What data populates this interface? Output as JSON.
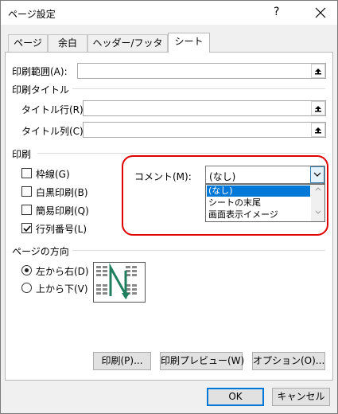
{
  "window": {
    "title": "ページ設定",
    "help_label": "?"
  },
  "tabs": [
    {
      "label": "ページ"
    },
    {
      "label": "余白"
    },
    {
      "label": "ヘッダー/フッター"
    },
    {
      "label": "シート"
    }
  ],
  "print_range": {
    "label": "印刷範囲(A):",
    "value": ""
  },
  "print_titles": {
    "group_label": "印刷タイトル",
    "rows_label": "タイトル行(R):",
    "rows_value": "",
    "cols_label": "タイトル列(C):",
    "cols_value": ""
  },
  "print": {
    "group_label": "印刷",
    "gridlines": {
      "label": "枠線(G)",
      "checked": false
    },
    "black_white": {
      "label": "白黒印刷(B)",
      "checked": false
    },
    "draft": {
      "label": "簡易印刷(Q)",
      "checked": false
    },
    "row_col_headers": {
      "label": "行列番号(L)",
      "checked": true
    }
  },
  "comments": {
    "label": "コメント(M):",
    "selected": "(なし)",
    "options": [
      "(なし)",
      "シートの末尾",
      "画面表示イメージ"
    ]
  },
  "page_order": {
    "group_label": "ページの方向",
    "left_to_right": {
      "label": "左から右(D)",
      "selected": true
    },
    "top_to_bottom": {
      "label": "上から下(V)",
      "selected": false
    }
  },
  "buttons": {
    "print": "印刷(P)...",
    "print_preview": "印刷プレビュー(W)",
    "options": "オプション(O)...",
    "ok": "OK",
    "cancel": "キャンセル"
  },
  "colors": {
    "accent": "#0078d7",
    "highlight_ring": "#e00000",
    "preview_arrow": "#1f7f5f"
  }
}
